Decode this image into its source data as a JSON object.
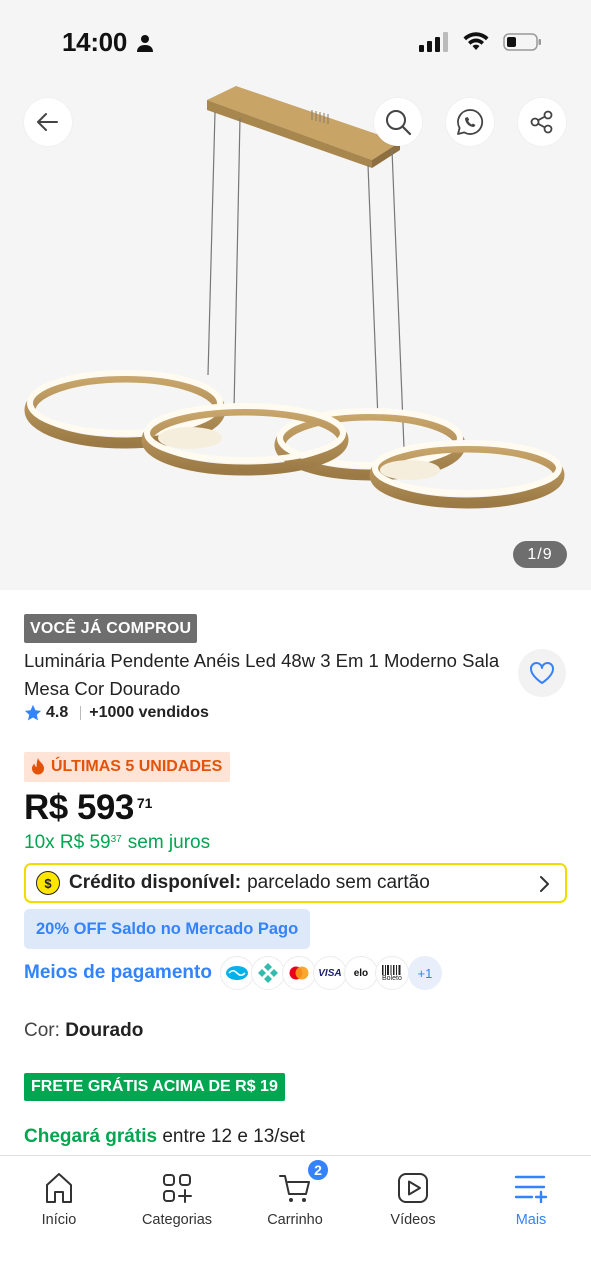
{
  "status_bar": {
    "time": "14:00"
  },
  "gallery": {
    "image_counter": "1/9"
  },
  "product": {
    "bought_tag": "VOCÊ JÁ COMPROU",
    "title": "Luminária Pendente Anéis Led 48w 3 Em 1 Moderno Sala Mesa Cor Dourado",
    "rating": "4.8",
    "sold": "+1000 vendidos",
    "urgency_tag": "ÚLTIMAS 5 UNIDADES",
    "price_main": "R$ 593",
    "price_cents": "71",
    "installments_prefix": "10x R$ 59",
    "installments_cents": "37",
    "installments_suffix": "sem juros",
    "credit_coin": "$",
    "credit_label": "Crédito disponível:",
    "credit_text": "parcelado sem cartão",
    "discount_tag": "20% OFF Saldo no Mercado Pago",
    "payment_label": "Meios de pagamento",
    "payment_visa": "VISA",
    "payment_elo": "elo",
    "payment_boleto": "Boleto",
    "payment_more": "+1",
    "color_label": "Cor:",
    "color_value": "Dourado",
    "shipping_tag": "FRETE GRÁTIS ACIMA DE R$ 19",
    "arrival_bold": "Chegará grátis",
    "arrival_text": "entre 12 e 13/set"
  },
  "nav": {
    "items": [
      {
        "label": "Início"
      },
      {
        "label": "Categorias"
      },
      {
        "label": "Carrinho",
        "badge": "2"
      },
      {
        "label": "Vídeos"
      },
      {
        "label": "Mais"
      }
    ]
  },
  "colors": {
    "blue": "#3483fa",
    "green": "#00a650",
    "orange": "#e3530a",
    "yellow": "#ffe600",
    "gold": "#b8925a"
  }
}
